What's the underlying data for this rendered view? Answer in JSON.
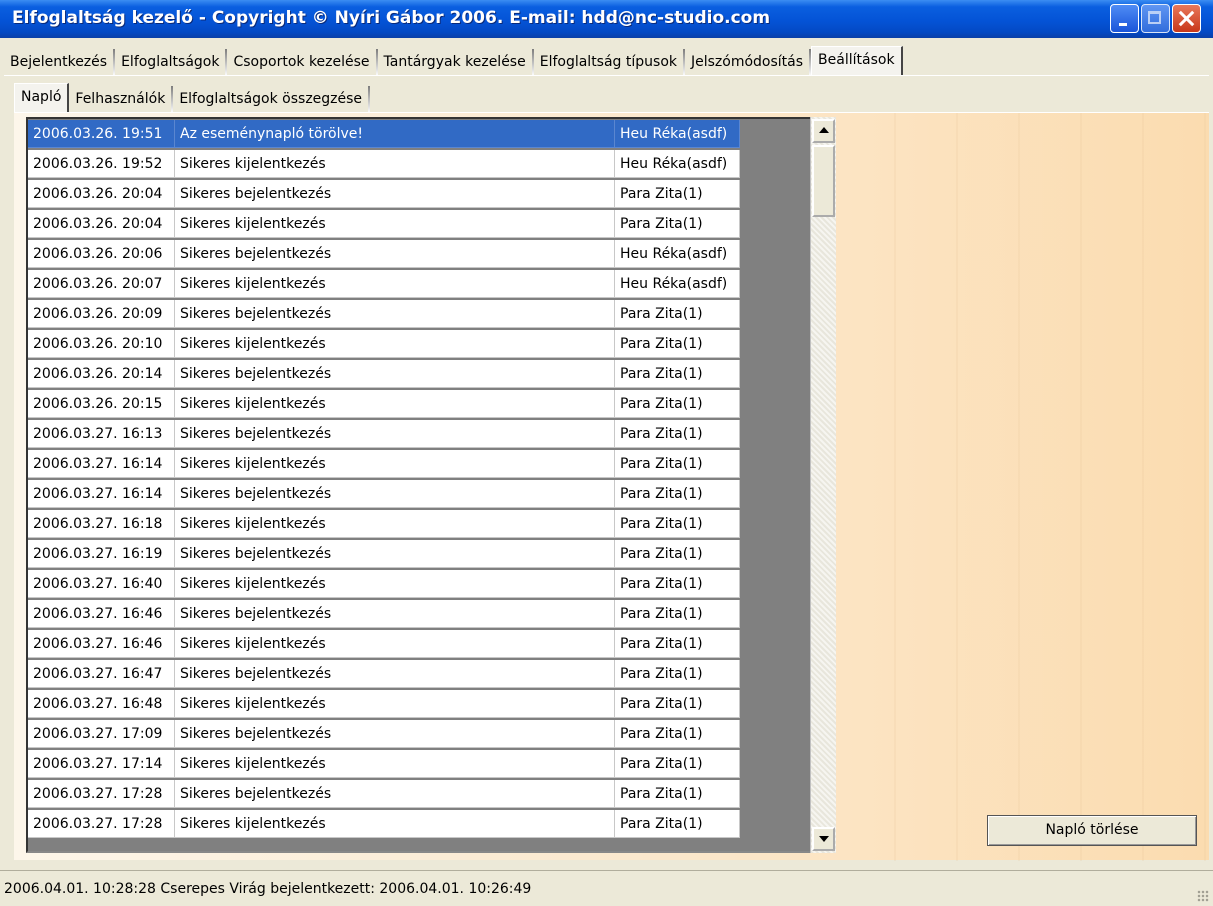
{
  "window": {
    "title": "Elfoglaltság kezelő - Copyright © Nyíri Gábor 2006. E-mail: hdd@nc-studio.com"
  },
  "tabs_main": [
    {
      "label": "Bejelentkezés"
    },
    {
      "label": "Elfoglaltságok"
    },
    {
      "label": "Csoportok kezelése"
    },
    {
      "label": "Tantárgyak kezelése"
    },
    {
      "label": "Elfoglaltság típusok"
    },
    {
      "label": "Jelszómódosítás"
    },
    {
      "label": "Beállítások",
      "active": true
    }
  ],
  "tabs_sub": [
    {
      "label": "Napló",
      "active": true
    },
    {
      "label": "Felhasználók"
    },
    {
      "label": "Elfoglaltságok összegzése"
    }
  ],
  "log": {
    "rows": [
      {
        "time": "2006.03.26. 19:51",
        "message": "Az eseménynapló törölve!",
        "user": "Heu Réka(asdf)",
        "selected": true
      },
      {
        "time": "2006.03.26. 19:52",
        "message": "Sikeres kijelentkezés",
        "user": "Heu Réka(asdf)"
      },
      {
        "time": "2006.03.26. 20:04",
        "message": "Sikeres bejelentkezés",
        "user": "Para Zita(1)"
      },
      {
        "time": "2006.03.26. 20:04",
        "message": "Sikeres kijelentkezés",
        "user": "Para Zita(1)"
      },
      {
        "time": "2006.03.26. 20:06",
        "message": "Sikeres bejelentkezés",
        "user": "Heu Réka(asdf)"
      },
      {
        "time": "2006.03.26. 20:07",
        "message": "Sikeres kijelentkezés",
        "user": "Heu Réka(asdf)"
      },
      {
        "time": "2006.03.26. 20:09",
        "message": "Sikeres bejelentkezés",
        "user": "Para Zita(1)"
      },
      {
        "time": "2006.03.26. 20:10",
        "message": "Sikeres kijelentkezés",
        "user": "Para Zita(1)"
      },
      {
        "time": "2006.03.26. 20:14",
        "message": "Sikeres bejelentkezés",
        "user": "Para Zita(1)"
      },
      {
        "time": "2006.03.26. 20:15",
        "message": "Sikeres kijelentkezés",
        "user": "Para Zita(1)"
      },
      {
        "time": "2006.03.27. 16:13",
        "message": "Sikeres bejelentkezés",
        "user": "Para Zita(1)"
      },
      {
        "time": "2006.03.27. 16:14",
        "message": "Sikeres kijelentkezés",
        "user": "Para Zita(1)"
      },
      {
        "time": "2006.03.27. 16:14",
        "message": "Sikeres bejelentkezés",
        "user": "Para Zita(1)"
      },
      {
        "time": "2006.03.27. 16:18",
        "message": "Sikeres kijelentkezés",
        "user": "Para Zita(1)"
      },
      {
        "time": "2006.03.27. 16:19",
        "message": "Sikeres bejelentkezés",
        "user": "Para Zita(1)"
      },
      {
        "time": "2006.03.27. 16:40",
        "message": "Sikeres kijelentkezés",
        "user": "Para Zita(1)"
      },
      {
        "time": "2006.03.27. 16:46",
        "message": "Sikeres bejelentkezés",
        "user": "Para Zita(1)"
      },
      {
        "time": "2006.03.27. 16:46",
        "message": "Sikeres kijelentkezés",
        "user": "Para Zita(1)"
      },
      {
        "time": "2006.03.27. 16:47",
        "message": "Sikeres bejelentkezés",
        "user": "Para Zita(1)"
      },
      {
        "time": "2006.03.27. 16:48",
        "message": "Sikeres kijelentkezés",
        "user": "Para Zita(1)"
      },
      {
        "time": "2006.03.27. 17:09",
        "message": "Sikeres bejelentkezés",
        "user": "Para Zita(1)"
      },
      {
        "time": "2006.03.27. 17:14",
        "message": "Sikeres kijelentkezés",
        "user": "Para Zita(1)"
      },
      {
        "time": "2006.03.27. 17:28",
        "message": "Sikeres bejelentkezés",
        "user": "Para Zita(1)"
      },
      {
        "time": "2006.03.27. 17:28",
        "message": "Sikeres kijelentkezés",
        "user": "Para Zita(1)"
      }
    ]
  },
  "actions": {
    "clear_log_label": "Napló törlése"
  },
  "status": {
    "text": "2006.04.01. 10:28:28  Cserepes Virág bejelentkezett: 2006.04.01. 10:26:49"
  },
  "colors": {
    "title_bar": "#0453d6",
    "selection": "#316ac5",
    "list_background": "#808080",
    "content_background": "#fce8cc"
  },
  "icons": {
    "minimize": "minimize-icon",
    "maximize": "maximize-icon",
    "close": "close-icon",
    "scroll_up": "arrow-up-icon",
    "scroll_down": "arrow-down-icon",
    "resize_grip": "resize-grip-icon"
  }
}
